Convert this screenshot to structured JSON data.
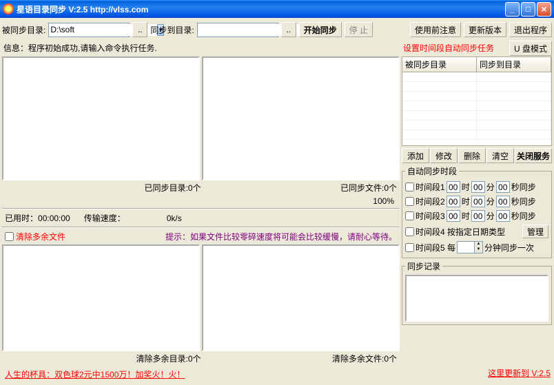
{
  "window": {
    "title": "星语目录同步  V:2.5 http://vlss.com"
  },
  "toolbar": {
    "src_label": "被同步目录:",
    "src_value": "D:\\soft",
    "dst_label": "同步到目录:",
    "dst_value": "",
    "browse": "..",
    "start": "开始同步",
    "stop": "停 止",
    "notice": "使用前注意",
    "update": "更新版本",
    "exit": "退出程序"
  },
  "info": "信息：程序初始成功,请输入命令执行任务.",
  "counts": {
    "synced_dirs": "已同步目录:0个",
    "synced_files": "已同步文件:0个",
    "percent": "100%"
  },
  "stats": {
    "elapsed_label": "已用时：",
    "elapsed_value": "00:00:00",
    "speed_label": "传输速度：",
    "speed_value": "0k/s"
  },
  "cleanup": {
    "checkbox_label": "清除多余文件",
    "hint": "提示：如果文件比较零碎速度将可能会比较缓慢，请耐心等待。",
    "cleared_dirs": "清除多余目录:0个",
    "cleared_files": "清除多余文件:0个"
  },
  "footer": {
    "ad": "人生的杯具：双色球2元中1500万！加奖火！火！"
  },
  "right": {
    "header": "设置时间段自动同步任务",
    "usb_mode": "U 盘模式",
    "col1": "被同步目录",
    "col2": "同步到目录",
    "add": "添加",
    "edit": "修改",
    "del": "删除",
    "clear": "清空",
    "close_svc": "关闭服务",
    "tsd_legend": "自动同步时段",
    "ts_label_1": "时间段1",
    "ts_label_2": "时间段2",
    "ts_label_3": "时间段3",
    "ts_label_4": "时间段4 按指定日期类型",
    "ts4_manage": "管理",
    "ts_label_5": "时间段5  每",
    "ts5_suffix": "分钟同步一次",
    "h": "00",
    "m": "00",
    "s": "00",
    "hu": "时",
    "mu": "分",
    "su": "秒同步",
    "log_legend": "同步记录",
    "ver": "这里更新到 V:2.5"
  }
}
